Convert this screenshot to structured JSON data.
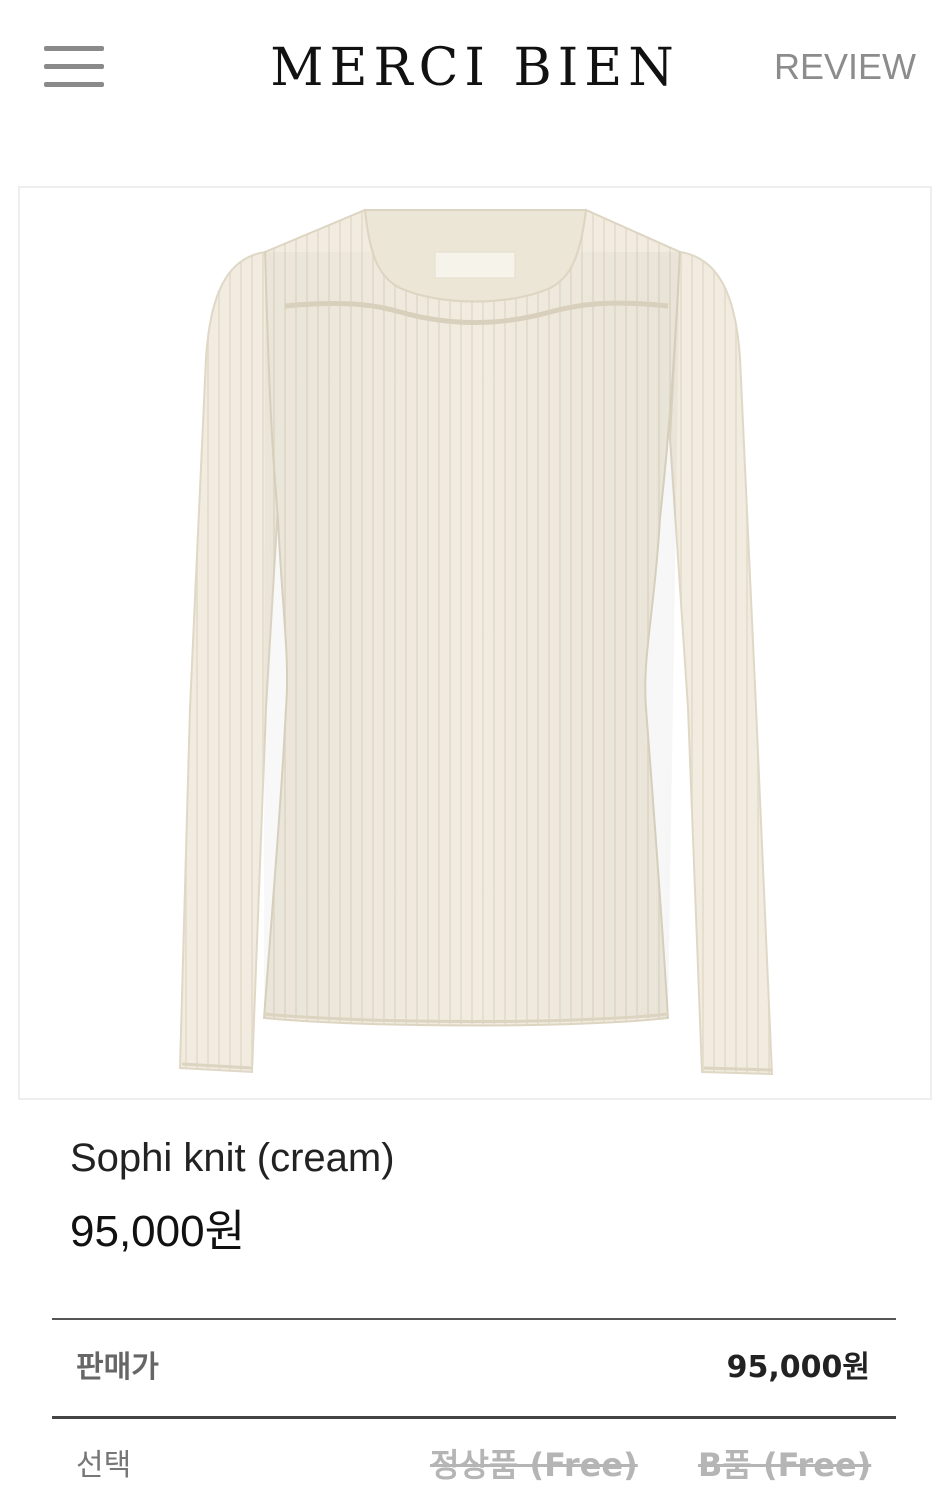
{
  "header": {
    "brand": "MERCI BIEN",
    "review_label": "REVIEW",
    "menu_icon": "hamburger-menu-icon"
  },
  "product": {
    "image_subject": "cream-ribbed-knit-top",
    "name": "Sophi knit (cream)",
    "price": "95,000원"
  },
  "details": {
    "sale_price_label": "판매가",
    "sale_price_value": "95,000원",
    "select_label": "선택",
    "options": [
      {
        "label": "정상품 (Free)",
        "available": false
      },
      {
        "label": "B품 (Free)",
        "available": false
      }
    ]
  },
  "colors": {
    "knit": "#f1ecdf",
    "knit_shadow": "#e3dccb",
    "option_disabled": "#b5b5b5"
  }
}
